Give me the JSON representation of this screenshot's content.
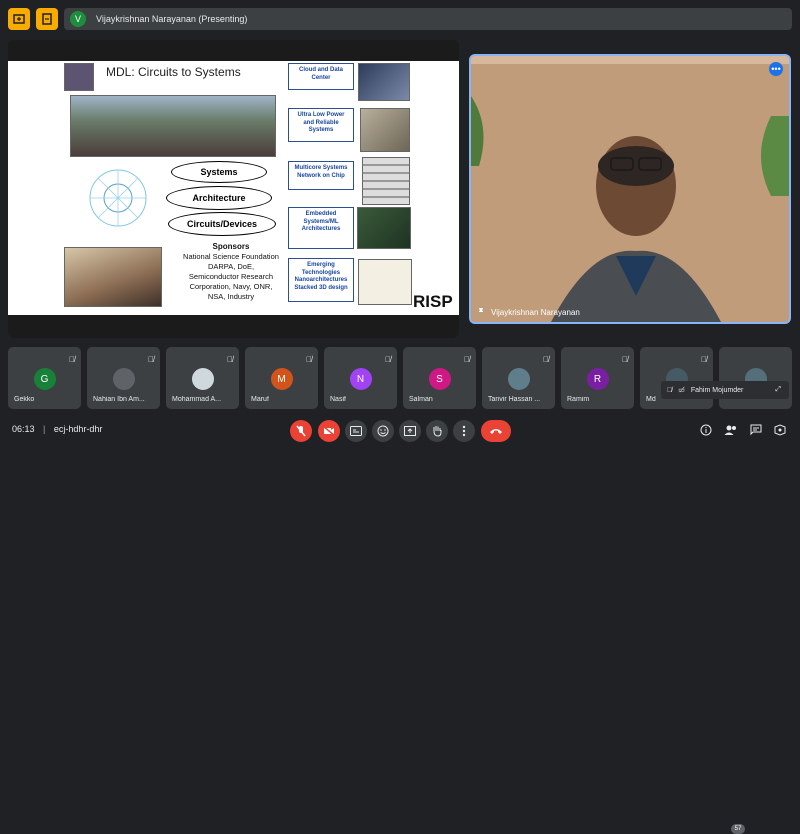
{
  "presenting_bar": {
    "avatar_letter": "V",
    "text": "Vijaykrishnan Narayanan (Presenting)"
  },
  "slide": {
    "title": "MDL: Circuits to Systems",
    "ovals": [
      "Systems",
      "Architecture",
      "Circuits/Devices"
    ],
    "sponsors_heading": "Sponsors",
    "sponsors_lines": [
      "National Science Foundation",
      "DARPA, DoE,",
      "Semiconductor Research",
      "Corporation, Navy, ONR,",
      "NSA, Industry"
    ],
    "right_boxes": [
      "Cloud and Data Center",
      "Ultra Low Power and Reliable Systems",
      "Multicore Systems Network on Chip",
      "Embedded Systems/ML Architectures",
      "Emerging Technologies Nanoarchitectures Stacked 3D design"
    ],
    "risp": "RISP"
  },
  "speaker": {
    "name": "Vijaykrishnan Narayanan",
    "menu_glyph": "•••"
  },
  "participants": [
    {
      "name": "Gekko",
      "letter": "G",
      "color": "#188038"
    },
    {
      "name": "Nahian Ibn Am...",
      "letter": "",
      "color": "#5f6368"
    },
    {
      "name": "Mohammad A...",
      "letter": "",
      "color": "#cfd8dc"
    },
    {
      "name": "Maruf",
      "letter": "M",
      "color": "#d2541b"
    },
    {
      "name": "Nasif",
      "letter": "N",
      "color": "#a142f4"
    },
    {
      "name": "Salman",
      "letter": "S",
      "color": "#d01884"
    },
    {
      "name": "Tanvir Hassan ...",
      "letter": "",
      "color": "#607d8b"
    },
    {
      "name": "Ramim",
      "letter": "R",
      "color": "#7b1fa2"
    },
    {
      "name": "Md",
      "letter": "",
      "color": "#455a64"
    },
    {
      "name": "",
      "letter": "",
      "color": "#546e7a"
    }
  ],
  "fahim": {
    "name": "Fahim Mojumder"
  },
  "bottom": {
    "time": "06:13",
    "separator": "|",
    "meeting_code": "ecj-hdhr-dhr",
    "people_count": "57"
  },
  "colors": {
    "accent": "#8ab4f8",
    "danger": "#ea4335",
    "warning": "#f9ab00"
  }
}
